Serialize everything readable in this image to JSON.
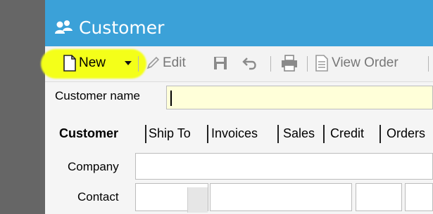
{
  "window": {
    "title": "Customer",
    "title_icon": "users-icon"
  },
  "toolbar": {
    "new_label": "New",
    "edit_label": "Edit",
    "view_order_label": "View Order",
    "icons": {
      "new": "new-document-icon",
      "dropdown": "dropdown-arrow-icon",
      "edit": "pencil-icon",
      "save": "save-icon",
      "undo": "undo-icon",
      "print": "print-icon",
      "view_order": "document-icon"
    }
  },
  "customer_name": {
    "label": "Customer name",
    "value": ""
  },
  "tabs": [
    {
      "label": "Customer",
      "active": true
    },
    {
      "label": "Ship To"
    },
    {
      "label": "Invoices"
    },
    {
      "label": "Sales"
    },
    {
      "label": "Credit"
    },
    {
      "label": "Orders"
    }
  ],
  "form": {
    "company_label": "Company",
    "contact_label": "Contact"
  },
  "colors": {
    "titlebar": "#3ba1d8",
    "highlight": "#f4ff19",
    "name_field_bg": "#ffffd9"
  }
}
